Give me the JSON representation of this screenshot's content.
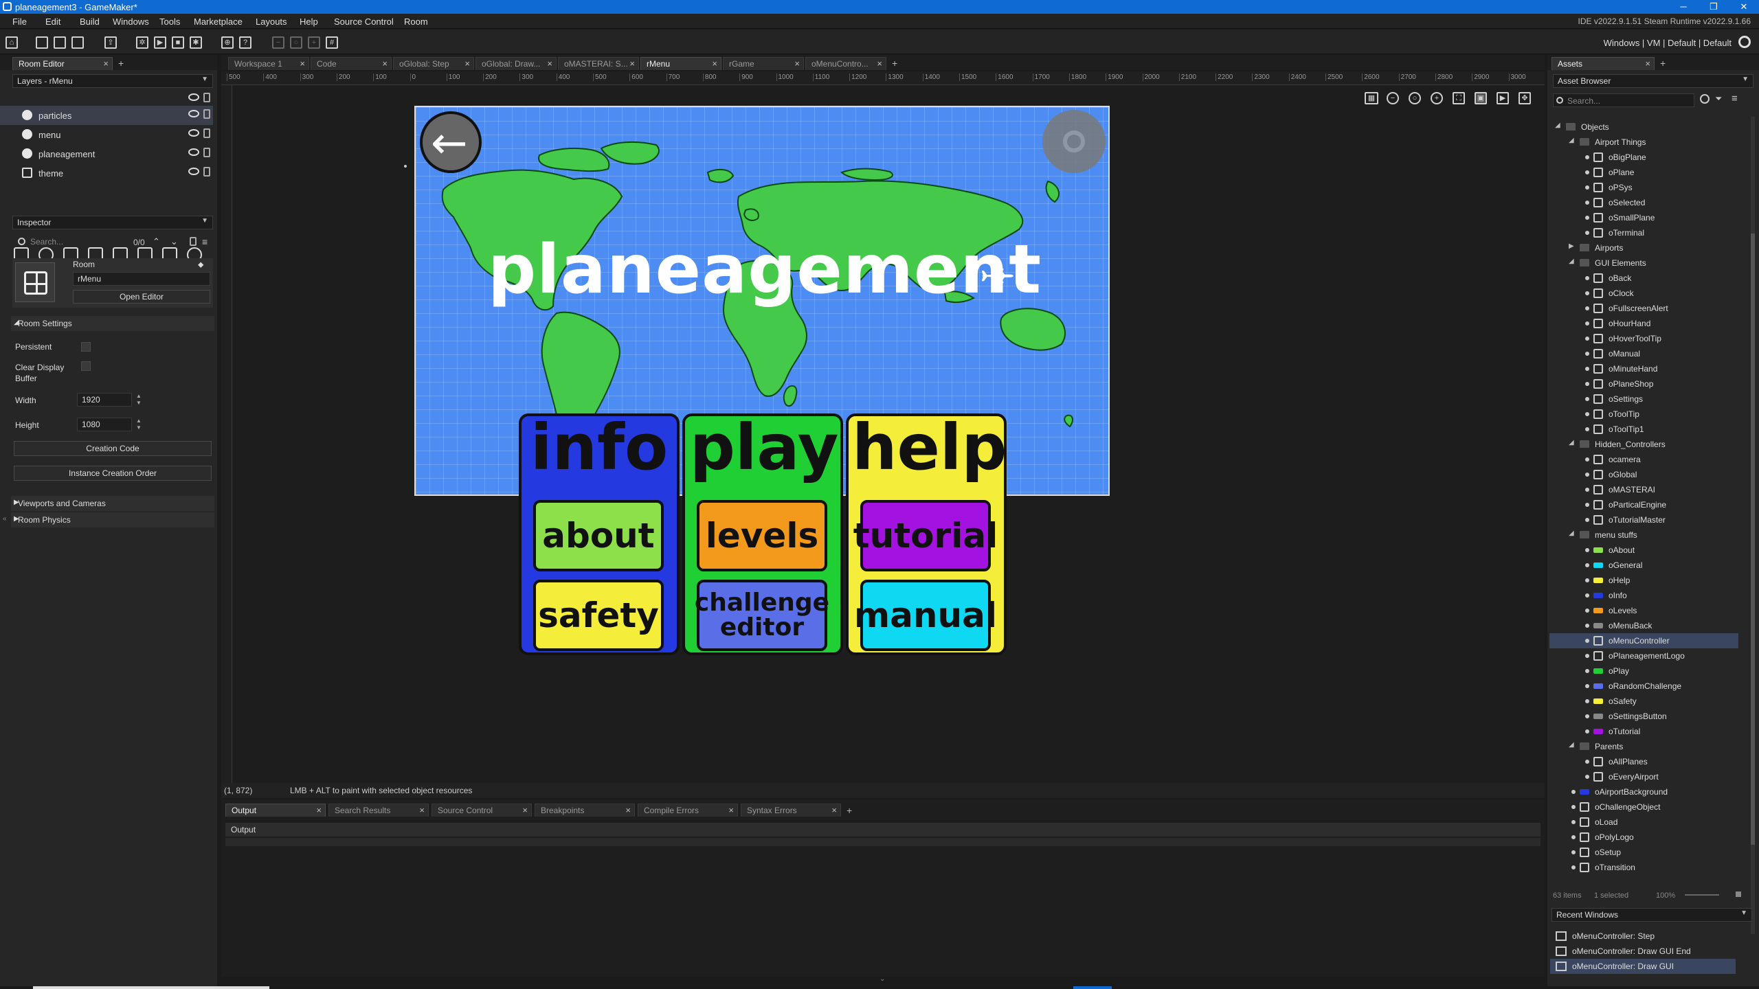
{
  "window": {
    "title": "planeagement3 - GameMaker*",
    "controls": [
      "─",
      "❐",
      "✕"
    ]
  },
  "menu": {
    "items": [
      "File",
      "Edit",
      "Build",
      "Windows",
      "Tools",
      "Marketplace",
      "Layouts",
      "Help",
      "Source Control",
      "Room"
    ],
    "version": "IDE v2022.9.1.51 Steam  Runtime v2022.9.1.66"
  },
  "toolbar": {
    "target": "Windows  |  VM  |  Default  |  Default"
  },
  "room_editor": {
    "tab": "Room Editor",
    "layers_dropdown": "Layers - rMenu",
    "layers": [
      "particles",
      "menu",
      "planeagement",
      "theme"
    ],
    "inspector_dropdown": "Inspector",
    "search_placeholder": "Search...",
    "search_count": "0/0",
    "room_label": "Room",
    "room_name": "rMenu",
    "open_editor": "Open Editor",
    "room_settings": "Room Settings",
    "persistent": "Persistent",
    "clear_display": "Clear Display Buffer",
    "width_label": "Width",
    "width_value": "1920",
    "height_label": "Height",
    "height_value": "1080",
    "creation_code": "Creation Code",
    "instance_order": "Instance Creation Order",
    "viewports": "Viewports and Cameras",
    "physics": "Room Physics"
  },
  "doc_tabs": [
    "Workspace 1",
    "Code",
    "oGlobal: Step",
    "oGlobal: Draw...",
    "oMASTERAI: S...",
    "rMenu",
    "rGame",
    "oMenuContro..."
  ],
  "ruler": [
    "500",
    "400",
    "300",
    "200",
    "100",
    "0",
    "100",
    "200",
    "300",
    "400",
    "500",
    "600",
    "700",
    "800",
    "900",
    "1000",
    "1100",
    "1200",
    "1300",
    "1400",
    "1500",
    "1600",
    "1700",
    "1800",
    "1900",
    "2000",
    "2100",
    "2200",
    "2300",
    "2400",
    "2500",
    "2600",
    "2700",
    "2800",
    "2900",
    "3000"
  ],
  "room_view": {
    "logo": "planeagement",
    "plane": "✈",
    "back_arrow": "←",
    "big": {
      "info": "info",
      "play": "play",
      "help": "help"
    },
    "buttons": {
      "about": "about",
      "levels": "levels",
      "tutorial": "tutorial",
      "safety": "safety",
      "challenge_line1": "challenge",
      "challenge_line2": "editor",
      "manual": "manual"
    },
    "colors": {
      "sky": "#4d8cf3",
      "land": "#44c94a",
      "info": "#2439e0",
      "play": "#1fcf34",
      "help": "#f4ee3b",
      "about": "#8ee04a",
      "levels": "#f39a1d",
      "tutorial": "#a312e0",
      "safety": "#f4ee3b",
      "challenge": "#5a6ee8",
      "manual": "#0ed8f2"
    }
  },
  "status": {
    "coords": "(1, 872)",
    "hint": "LMB + ALT to paint with selected object resources"
  },
  "output": {
    "tabs": [
      "Output",
      "Search Results",
      "Source Control",
      "Breakpoints",
      "Compile Errors",
      "Syntax Errors"
    ],
    "header": "Output"
  },
  "assets": {
    "tab": "Assets",
    "browser": "Asset Browser",
    "search_placeholder": "Search...",
    "tree": [
      {
        "name": "Objects",
        "level": 0,
        "type": "folder",
        "open": true
      },
      {
        "name": "Airport Things",
        "level": 1,
        "type": "folder",
        "open": true
      },
      {
        "name": "oBigPlane",
        "level": 2,
        "type": "obj"
      },
      {
        "name": "oPlane",
        "level": 2,
        "type": "obj"
      },
      {
        "name": "oPSys",
        "level": 2,
        "type": "obj"
      },
      {
        "name": "oSelected",
        "level": 2,
        "type": "obj"
      },
      {
        "name": "oSmallPlane",
        "level": 2,
        "type": "obj"
      },
      {
        "name": "oTerminal",
        "level": 2,
        "type": "obj"
      },
      {
        "name": "Airports",
        "level": 1,
        "type": "folder",
        "open": false
      },
      {
        "name": "GUI Elements",
        "level": 1,
        "type": "folder",
        "open": true
      },
      {
        "name": "oBack",
        "level": 2,
        "type": "obj"
      },
      {
        "name": "oClock",
        "level": 2,
        "type": "obj"
      },
      {
        "name": "oFullscreenAlert",
        "level": 2,
        "type": "obj"
      },
      {
        "name": "oHourHand",
        "level": 2,
        "type": "obj"
      },
      {
        "name": "oHoverToolTip",
        "level": 2,
        "type": "obj"
      },
      {
        "name": "oManual",
        "level": 2,
        "type": "obj"
      },
      {
        "name": "oMinuteHand",
        "level": 2,
        "type": "obj"
      },
      {
        "name": "oPlaneShop",
        "level": 2,
        "type": "obj"
      },
      {
        "name": "oSettings",
        "level": 2,
        "type": "obj"
      },
      {
        "name": "oToolTip",
        "level": 2,
        "type": "obj"
      },
      {
        "name": "oToolTip1",
        "level": 2,
        "type": "obj"
      },
      {
        "name": "Hidden_Controllers",
        "level": 1,
        "type": "folder",
        "open": true
      },
      {
        "name": "ocamera",
        "level": 2,
        "type": "obj"
      },
      {
        "name": "oGlobal",
        "level": 2,
        "type": "obj"
      },
      {
        "name": "oMASTERAI",
        "level": 2,
        "type": "obj"
      },
      {
        "name": "oParticalEngine",
        "level": 2,
        "type": "obj"
      },
      {
        "name": "oTutorialMaster",
        "level": 2,
        "type": "obj"
      },
      {
        "name": "menu stuffs",
        "level": 1,
        "type": "folder",
        "open": true
      },
      {
        "name": "oAbout",
        "level": 2,
        "type": "obj"
      },
      {
        "name": "oGeneral",
        "level": 2,
        "type": "obj"
      },
      {
        "name": "oHelp",
        "level": 2,
        "type": "obj"
      },
      {
        "name": "oInfo",
        "level": 2,
        "type": "obj"
      },
      {
        "name": "oLevels",
        "level": 2,
        "type": "obj"
      },
      {
        "name": "oMenuBack",
        "level": 2,
        "type": "obj"
      },
      {
        "name": "oMenuController",
        "level": 2,
        "type": "obj",
        "selected": true
      },
      {
        "name": "oPlaneagementLogo",
        "level": 2,
        "type": "obj"
      },
      {
        "name": "oPlay",
        "level": 2,
        "type": "obj"
      },
      {
        "name": "oRandomChallenge",
        "level": 2,
        "type": "obj"
      },
      {
        "name": "oSafety",
        "level": 2,
        "type": "obj"
      },
      {
        "name": "oSettingsButton",
        "level": 2,
        "type": "obj"
      },
      {
        "name": "oTutorial",
        "level": 2,
        "type": "obj"
      },
      {
        "name": "Parents",
        "level": 1,
        "type": "folder",
        "open": true
      },
      {
        "name": "oAllPlanes",
        "level": 2,
        "type": "obj"
      },
      {
        "name": "oEveryAirport",
        "level": 2,
        "type": "obj"
      },
      {
        "name": "oAirportBackground",
        "level": 1,
        "type": "obj"
      },
      {
        "name": "oChallengeObject",
        "level": 1,
        "type": "obj"
      },
      {
        "name": "oLoad",
        "level": 1,
        "type": "obj"
      },
      {
        "name": "oPolyLogo",
        "level": 1,
        "type": "obj"
      },
      {
        "name": "oSetup",
        "level": 1,
        "type": "obj"
      },
      {
        "name": "oTransition",
        "level": 1,
        "type": "obj"
      }
    ],
    "footer_items": "63 items",
    "footer_selected": "1 selected",
    "footer_zoom": "100%"
  },
  "recent": {
    "title": "Recent Windows",
    "items": [
      "oMenuController: Step",
      "oMenuController: Draw GUI End",
      "oMenuController: Draw GUI"
    ]
  }
}
